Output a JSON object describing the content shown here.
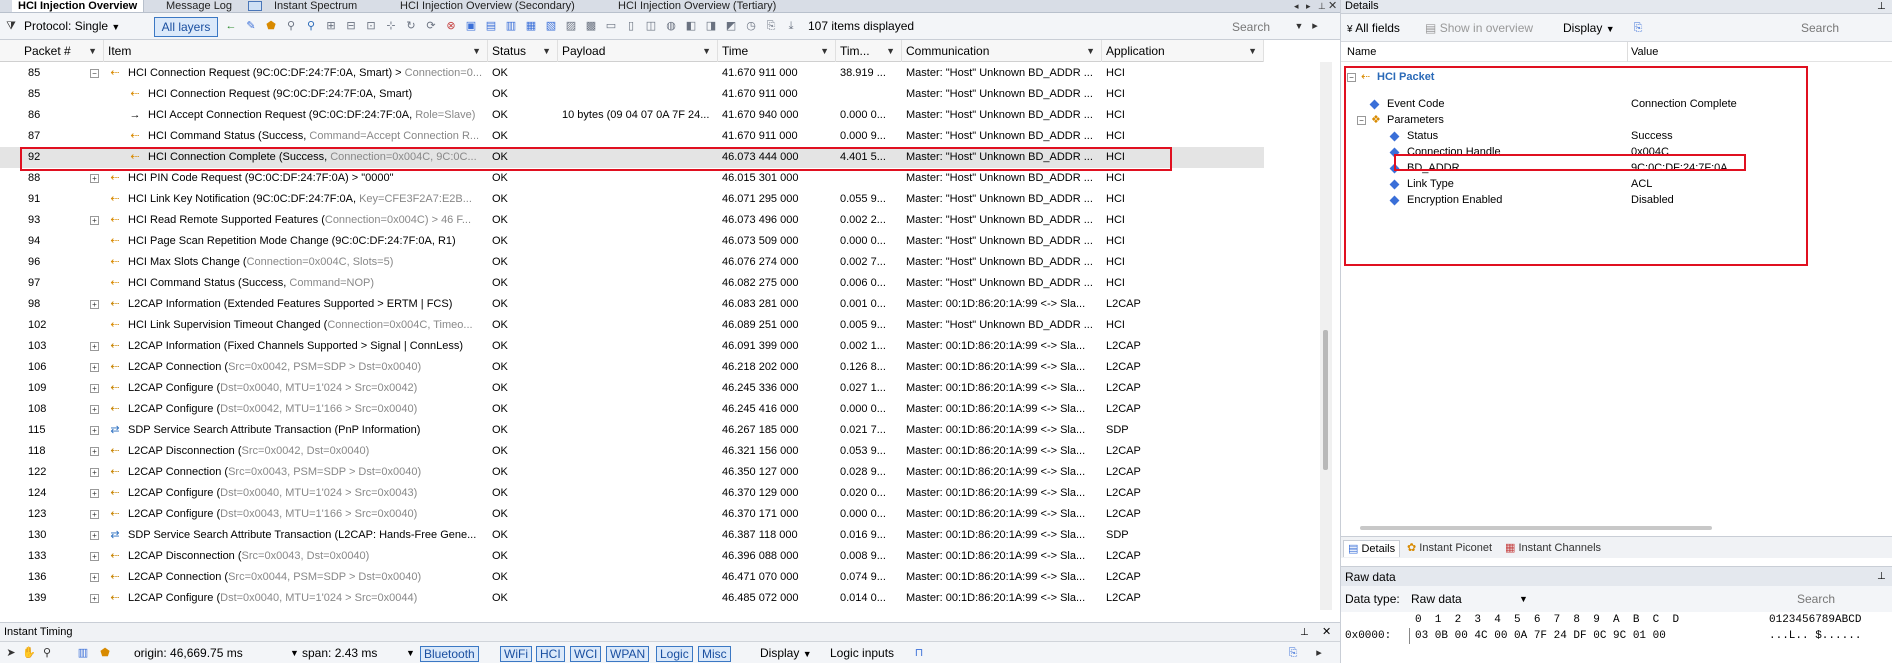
{
  "tabs": [
    {
      "label": "HCI Injection Overview",
      "active": true
    },
    {
      "label": "Message Log"
    },
    {
      "label": "Instant Spectrum"
    },
    {
      "label": "HCI Injection Overview (Secondary)"
    },
    {
      "label": "HCI Injection Overview (Tertiary)"
    }
  ],
  "toolbar": {
    "protocol_label": "Protocol: Single",
    "layers_label": "All layers",
    "items_displayed": "107 items displayed",
    "search_placeholder": "Search"
  },
  "columns": [
    "Packet #",
    "Item",
    "Status",
    "Payload",
    "Time",
    "Tim...",
    "Communication",
    "Application"
  ],
  "rows": [
    {
      "packet": "85",
      "indent": 0,
      "expander": "minus",
      "icon": "hci",
      "item": "HCI Connection Request (9C:0C:DF:24:7F:0A, Smart) > ",
      "item_gray": "Connection=0...",
      "status": "OK",
      "payload": "",
      "time": "41.670 911 000",
      "delta": "38.919 ...",
      "comm": "Master: \"Host\" Unknown BD_ADDR ...",
      "app": "HCI"
    },
    {
      "packet": "85",
      "indent": 1,
      "expander": "",
      "icon": "hci",
      "item": "HCI Connection Request (9C:0C:DF:24:7F:0A, Smart)",
      "item_gray": "",
      "status": "OK",
      "payload": "",
      "time": "41.670 911 000",
      "delta": "",
      "comm": "Master: \"Host\" Unknown BD_ADDR ...",
      "app": "HCI"
    },
    {
      "packet": "86",
      "indent": 1,
      "expander": "",
      "icon": "arrow",
      "item": "HCI Accept Connection Request (9C:0C:DF:24:7F:0A, ",
      "item_gray": "Role=Slave)",
      "status": "OK",
      "payload": "10 bytes (09 04 07 0A 7F 24...",
      "time": "41.670 940 000",
      "delta": "0.000 0...",
      "comm": "Master: \"Host\" Unknown BD_ADDR ...",
      "app": "HCI"
    },
    {
      "packet": "87",
      "indent": 1,
      "expander": "",
      "icon": "hci",
      "item": "HCI Command Status (Success, ",
      "item_gray": "Command=Accept Connection R...",
      "status": "OK",
      "payload": "",
      "time": "41.670 911 000",
      "delta": "0.000 9...",
      "comm": "Master: \"Host\" Unknown BD_ADDR ...",
      "app": "HCI"
    },
    {
      "packet": "92",
      "indent": 1,
      "expander": "",
      "icon": "hci",
      "item": "HCI Connection Complete (Success, ",
      "item_gray": "Connection=0x004C, 9C:0C...",
      "status": "OK",
      "payload": "",
      "time": "46.073 444 000",
      "delta": "4.401 5...",
      "comm": "Master: \"Host\" Unknown BD_ADDR ...",
      "app": "HCI",
      "selected": true
    },
    {
      "packet": "88",
      "indent": 0,
      "expander": "plus",
      "icon": "hci",
      "item": "HCI PIN Code Request (9C:0C:DF:24:7F:0A) > \"0000\"",
      "item_gray": "",
      "status": "OK",
      "payload": "",
      "time": "46.015 301 000",
      "delta": "",
      "comm": "Master: \"Host\" Unknown BD_ADDR ...",
      "app": "HCI"
    },
    {
      "packet": "91",
      "indent": 0,
      "expander": "",
      "icon": "hci",
      "item": "HCI Link Key Notification (9C:0C:DF:24:7F:0A, ",
      "item_gray": "Key=CFE3F2A7:E2B...",
      "status": "OK",
      "payload": "",
      "time": "46.071 295 000",
      "delta": "0.055 9...",
      "comm": "Master: \"Host\" Unknown BD_ADDR ...",
      "app": "HCI"
    },
    {
      "packet": "93",
      "indent": 0,
      "expander": "plus",
      "icon": "hci",
      "item": "HCI Read Remote Supported Features (",
      "item_gray": "Connection=0x004C) > 46 F...",
      "status": "OK",
      "payload": "",
      "time": "46.073 496 000",
      "delta": "0.002 2...",
      "comm": "Master: \"Host\" Unknown BD_ADDR ...",
      "app": "HCI"
    },
    {
      "packet": "94",
      "indent": 0,
      "expander": "",
      "icon": "hci",
      "item": "HCI Page Scan Repetition Mode Change (9C:0C:DF:24:7F:0A, R1)",
      "item_gray": "",
      "status": "OK",
      "payload": "",
      "time": "46.073 509 000",
      "delta": "0.000 0...",
      "comm": "Master: \"Host\" Unknown BD_ADDR ...",
      "app": "HCI"
    },
    {
      "packet": "96",
      "indent": 0,
      "expander": "",
      "icon": "hci",
      "item": "HCI Max Slots Change (",
      "item_gray": "Connection=0x004C, Slots=5)",
      "status": "OK",
      "payload": "",
      "time": "46.076 274 000",
      "delta": "0.002 7...",
      "comm": "Master: \"Host\" Unknown BD_ADDR ...",
      "app": "HCI"
    },
    {
      "packet": "97",
      "indent": 0,
      "expander": "",
      "icon": "hci",
      "item": "HCI Command Status (Success, ",
      "item_gray": "Command=NOP)",
      "status": "OK",
      "payload": "",
      "time": "46.082 275 000",
      "delta": "0.006 0...",
      "comm": "Master: \"Host\" Unknown BD_ADDR ...",
      "app": "HCI"
    },
    {
      "packet": "98",
      "indent": 0,
      "expander": "plus",
      "icon": "l2",
      "item": "L2CAP Information (Extended Features Supported > ERTM | FCS)",
      "item_gray": "",
      "status": "OK",
      "payload": "",
      "time": "46.083 281 000",
      "delta": "0.001 0...",
      "comm": "Master: 00:1D:86:20:1A:99 <-> Sla...",
      "app": "L2CAP"
    },
    {
      "packet": "102",
      "indent": 0,
      "expander": "",
      "icon": "hci",
      "item": "HCI Link Supervision Timeout Changed (",
      "item_gray": "Connection=0x004C, Timeo...",
      "status": "OK",
      "payload": "",
      "time": "46.089 251 000",
      "delta": "0.005 9...",
      "comm": "Master: \"Host\" Unknown BD_ADDR ...",
      "app": "HCI"
    },
    {
      "packet": "103",
      "indent": 0,
      "expander": "plus",
      "icon": "l2",
      "item": "L2CAP Information (Fixed Channels Supported > Signal | ConnLess)",
      "item_gray": "",
      "status": "OK",
      "payload": "",
      "time": "46.091 399 000",
      "delta": "0.002 1...",
      "comm": "Master: 00:1D:86:20:1A:99 <-> Sla...",
      "app": "L2CAP"
    },
    {
      "packet": "106",
      "indent": 0,
      "expander": "plus",
      "icon": "l2",
      "item": "L2CAP Connection (",
      "item_gray": "Src=0x0042, PSM=SDP > Dst=0x0040)",
      "status": "OK",
      "payload": "",
      "time": "46.218 202 000",
      "delta": "0.126 8...",
      "comm": "Master: 00:1D:86:20:1A:99 <-> Sla...",
      "app": "L2CAP"
    },
    {
      "packet": "109",
      "indent": 0,
      "expander": "plus",
      "icon": "l2",
      "item": "L2CAP Configure (",
      "item_gray": "Dst=0x0040, MTU=1'024 > Src=0x0042)",
      "status": "OK",
      "payload": "",
      "time": "46.245 336 000",
      "delta": "0.027 1...",
      "comm": "Master: 00:1D:86:20:1A:99 <-> Sla...",
      "app": "L2CAP"
    },
    {
      "packet": "108",
      "indent": 0,
      "expander": "plus",
      "icon": "l2",
      "item": "L2CAP Configure (",
      "item_gray": "Dst=0x0042, MTU=1'166 > Src=0x0040)",
      "status": "OK",
      "payload": "",
      "time": "46.245 416 000",
      "delta": "0.000 0...",
      "comm": "Master: 00:1D:86:20:1A:99 <-> Sla...",
      "app": "L2CAP"
    },
    {
      "packet": "115",
      "indent": 0,
      "expander": "plus",
      "icon": "sdp",
      "item": "SDP Service Search Attribute Transaction (PnP Information)",
      "item_gray": "",
      "status": "OK",
      "payload": "",
      "time": "46.267 185 000",
      "delta": "0.021 7...",
      "comm": "Master: 00:1D:86:20:1A:99 <-> Sla...",
      "app": "SDP"
    },
    {
      "packet": "118",
      "indent": 0,
      "expander": "plus",
      "icon": "l2",
      "item": "L2CAP Disconnection (",
      "item_gray": "Src=0x0042, Dst=0x0040)",
      "status": "OK",
      "payload": "",
      "time": "46.321 156 000",
      "delta": "0.053 9...",
      "comm": "Master: 00:1D:86:20:1A:99 <-> Sla...",
      "app": "L2CAP"
    },
    {
      "packet": "122",
      "indent": 0,
      "expander": "plus",
      "icon": "l2",
      "item": "L2CAP Connection (",
      "item_gray": "Src=0x0043, PSM=SDP > Dst=0x0040)",
      "status": "OK",
      "payload": "",
      "time": "46.350 127 000",
      "delta": "0.028 9...",
      "comm": "Master: 00:1D:86:20:1A:99 <-> Sla...",
      "app": "L2CAP"
    },
    {
      "packet": "124",
      "indent": 0,
      "expander": "plus",
      "icon": "l2",
      "item": "L2CAP Configure (",
      "item_gray": "Dst=0x0040, MTU=1'024 > Src=0x0043)",
      "status": "OK",
      "payload": "",
      "time": "46.370 129 000",
      "delta": "0.020 0...",
      "comm": "Master: 00:1D:86:20:1A:99 <-> Sla...",
      "app": "L2CAP"
    },
    {
      "packet": "123",
      "indent": 0,
      "expander": "plus",
      "icon": "l2",
      "item": "L2CAP Configure (",
      "item_gray": "Dst=0x0043, MTU=1'166 > Src=0x0040)",
      "status": "OK",
      "payload": "",
      "time": "46.370 171 000",
      "delta": "0.000 0...",
      "comm": "Master: 00:1D:86:20:1A:99 <-> Sla...",
      "app": "L2CAP"
    },
    {
      "packet": "130",
      "indent": 0,
      "expander": "plus",
      "icon": "sdp",
      "item": "SDP Service Search Attribute Transaction (L2CAP: Hands-Free Gene...",
      "item_gray": "",
      "status": "OK",
      "payload": "",
      "time": "46.387 118 000",
      "delta": "0.016 9...",
      "comm": "Master: 00:1D:86:20:1A:99 <-> Sla...",
      "app": "SDP"
    },
    {
      "packet": "133",
      "indent": 0,
      "expander": "plus",
      "icon": "l2",
      "item": "L2CAP Disconnection (",
      "item_gray": "Src=0x0043, Dst=0x0040)",
      "status": "OK",
      "payload": "",
      "time": "46.396 088 000",
      "delta": "0.008 9...",
      "comm": "Master: 00:1D:86:20:1A:99 <-> Sla...",
      "app": "L2CAP"
    },
    {
      "packet": "136",
      "indent": 0,
      "expander": "plus",
      "icon": "l2",
      "item": "L2CAP Connection (",
      "item_gray": "Src=0x0044, PSM=SDP > Dst=0x0040)",
      "status": "OK",
      "payload": "",
      "time": "46.471 070 000",
      "delta": "0.074 9...",
      "comm": "Master: 00:1D:86:20:1A:99 <-> Sla...",
      "app": "L2CAP"
    },
    {
      "packet": "139",
      "indent": 0,
      "expander": "plus",
      "icon": "l2",
      "item": "L2CAP Configure (",
      "item_gray": "Dst=0x0040, MTU=1'024 > Src=0x0044)",
      "status": "OK",
      "payload": "",
      "time": "46.485 072 000",
      "delta": "0.014 0...",
      "comm": "Master: 00:1D:86:20:1A:99 <-> Sla...",
      "app": "L2CAP"
    }
  ],
  "timing": {
    "title": "Instant Timing",
    "origin": "origin:  46,669.75 ms",
    "span": "span:  2.43 ms",
    "tags": [
      "Bluetooth",
      "WiFi",
      "HCI",
      "WCI",
      "WPAN",
      "Logic",
      "Misc"
    ],
    "display": "Display",
    "logic_inputs": "Logic inputs"
  },
  "details": {
    "title": "Details",
    "all_fields": "All fields",
    "show_overview": "Show in overview",
    "display": "Display",
    "search": "Search",
    "col_name": "Name",
    "col_value": "Value",
    "root": "HCI Packet",
    "fields": [
      {
        "name": "Event Code",
        "value": "Connection Complete",
        "level": 1
      },
      {
        "name": "Parameters",
        "value": "",
        "level": 1,
        "group": true
      },
      {
        "name": "Status",
        "value": "Success",
        "level": 2
      },
      {
        "name": "Connection Handle",
        "value": "0x004C",
        "level": 2,
        "highlight": true
      },
      {
        "name": "BD_ADDR",
        "value": "9C:0C:DF:24:7F:0A",
        "level": 2
      },
      {
        "name": "Link Type",
        "value": "ACL",
        "level": 2
      },
      {
        "name": "Encryption Enabled",
        "value": "Disabled",
        "level": 2
      }
    ],
    "bottom_tabs": [
      "Details",
      "Instant Piconet",
      "Instant Channels"
    ]
  },
  "raw": {
    "title": "Raw data",
    "data_type_label": "Data type:",
    "data_type_value": "Raw data",
    "search": "Search",
    "hex_header": "0  1  2  3  4  5  6  7  8  9  A  B  C  D",
    "ascii_header": "0123456789ABCD",
    "offset": "0x0000:",
    "hex_bytes": "03 0B 00 4C 00 0A 7F 24 DF 0C 9C 01 00",
    "ascii": "...L.. $......"
  }
}
